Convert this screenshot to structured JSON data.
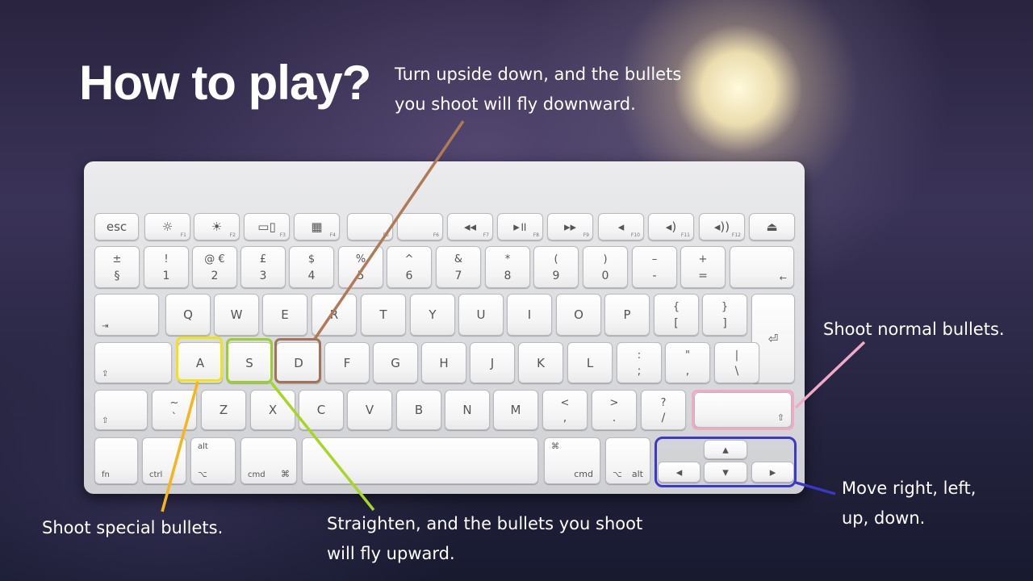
{
  "title": "How to play?",
  "notes": {
    "d_key": "Turn upside down, and the bullets\nyou shoot will fly downward.",
    "shift_key": "Shoot normal bullets.",
    "a_key": "Shoot special bullets.",
    "s_key": "Straighten, and the bullets you shoot\nwill fly upward.",
    "arrows": "Move right, left,\nup, down."
  },
  "colors": {
    "a_highlight": "#f2e21a",
    "s_highlight": "#9ccf2a",
    "d_highlight": "#a0735a",
    "shift_highlight": "#f2a9c4",
    "arrows_highlight": "#3b39c8",
    "a_line": "#f5b51c",
    "s_line": "#a6d626",
    "d_line": "#b07a58",
    "shift_line": "#f0aac5",
    "arrows_line": "#3a36c6"
  },
  "keys": {
    "row1": [
      "esc",
      "☼",
      "☀",
      "▭▯",
      "▦",
      "",
      "",
      "◂◂",
      "▸॥",
      "▸▸",
      "◂",
      "◂)",
      "◂))",
      "⏏"
    ],
    "row1_fn": [
      "",
      "F1",
      "F2",
      "F3",
      "F4",
      "F5",
      "F6",
      "F7",
      "F8",
      "F9",
      "F10",
      "F11",
      "F12",
      ""
    ],
    "row2_top": [
      "±",
      "!",
      "@ €",
      "£",
      "$",
      "%",
      "^",
      "&",
      "*",
      "(",
      ")",
      "–",
      "+",
      ""
    ],
    "row2_bot": [
      "§",
      "1",
      "2",
      "3",
      "4",
      "5",
      "6",
      "7",
      "8",
      "9",
      "0",
      "-",
      "=",
      "←"
    ],
    "row3": [
      "⇥",
      "Q",
      "W",
      "E",
      "R",
      "T",
      "Y",
      "U",
      "I",
      "O",
      "P"
    ],
    "row3_br_top": [
      "{",
      "}"
    ],
    "row3_br_bot": [
      "[",
      "]"
    ],
    "enter": "⏎",
    "row4": [
      "A",
      "S",
      "D",
      "F",
      "G",
      "H",
      "J",
      "K",
      "L"
    ],
    "row4_p_top": [
      ":",
      "\"",
      "|"
    ],
    "row4_p_bot": [
      ";",
      ",",
      "\\"
    ],
    "caps": "⇪",
    "row5": [
      "Z",
      "X",
      "C",
      "V",
      "B",
      "N",
      "M"
    ],
    "row5_p_top": [
      "~",
      "<",
      ">",
      "?"
    ],
    "row5_p_bot": [
      "`",
      ",",
      ".",
      "/"
    ],
    "shift": "⇧",
    "row6": {
      "fn": "fn",
      "ctrl": "ctrl",
      "alt": "alt",
      "opt": "⌥",
      "cmd": "cmd",
      "cmd_sym": "⌘",
      "alt_r": "alt",
      "opt_r": "⌥"
    },
    "arrows": {
      "up": "▴",
      "left": "◂",
      "down": "▾",
      "right": "▸"
    },
    "x": "×"
  }
}
